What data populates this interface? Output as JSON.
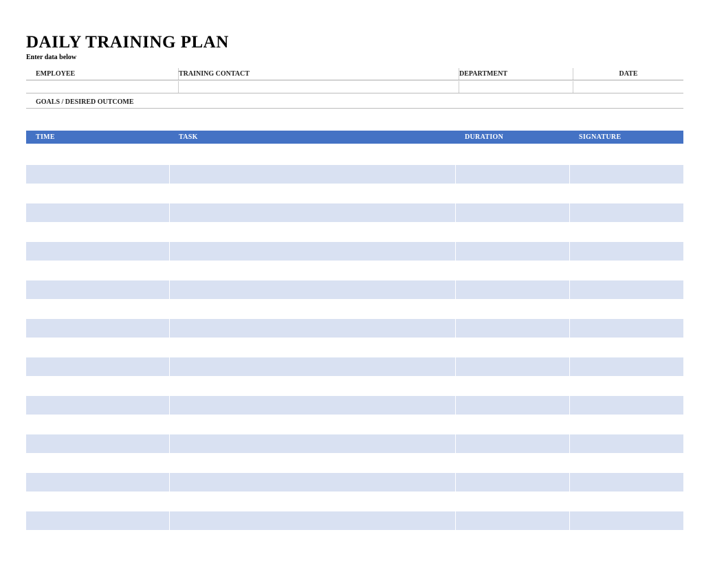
{
  "header": {
    "title": "DAILY TRAINING PLAN",
    "subtitle": "Enter data below"
  },
  "info": {
    "employee_label": "EMPLOYEE",
    "contact_label": "TRAINING CONTACT",
    "department_label": "DEPARTMENT",
    "date_label": "DATE",
    "employee_value": "",
    "contact_value": "",
    "department_value": "",
    "date_value": ""
  },
  "goals": {
    "label": "GOALS / DESIRED OUTCOME",
    "value": ""
  },
  "table": {
    "headers": {
      "time": "TIME",
      "task": "TASK",
      "duration": "DURATION",
      "signature": "SIGNATURE"
    },
    "rows": [
      {
        "time": "",
        "task": "",
        "duration": "",
        "signature": ""
      },
      {
        "time": "",
        "task": "",
        "duration": "",
        "signature": ""
      },
      {
        "time": "",
        "task": "",
        "duration": "",
        "signature": ""
      },
      {
        "time": "",
        "task": "",
        "duration": "",
        "signature": ""
      },
      {
        "time": "",
        "task": "",
        "duration": "",
        "signature": ""
      },
      {
        "time": "",
        "task": "",
        "duration": "",
        "signature": ""
      },
      {
        "time": "",
        "task": "",
        "duration": "",
        "signature": ""
      },
      {
        "time": "",
        "task": "",
        "duration": "",
        "signature": ""
      },
      {
        "time": "",
        "task": "",
        "duration": "",
        "signature": ""
      },
      {
        "time": "",
        "task": "",
        "duration": "",
        "signature": ""
      },
      {
        "time": "",
        "task": "",
        "duration": "",
        "signature": ""
      },
      {
        "time": "",
        "task": "",
        "duration": "",
        "signature": ""
      },
      {
        "time": "",
        "task": "",
        "duration": "",
        "signature": ""
      },
      {
        "time": "",
        "task": "",
        "duration": "",
        "signature": ""
      },
      {
        "time": "",
        "task": "",
        "duration": "",
        "signature": ""
      },
      {
        "time": "",
        "task": "",
        "duration": "",
        "signature": ""
      },
      {
        "time": "",
        "task": "",
        "duration": "",
        "signature": ""
      },
      {
        "time": "",
        "task": "",
        "duration": "",
        "signature": ""
      },
      {
        "time": "",
        "task": "",
        "duration": "",
        "signature": ""
      },
      {
        "time": "",
        "task": "",
        "duration": "",
        "signature": ""
      },
      {
        "time": "",
        "task": "",
        "duration": "",
        "signature": ""
      }
    ]
  }
}
